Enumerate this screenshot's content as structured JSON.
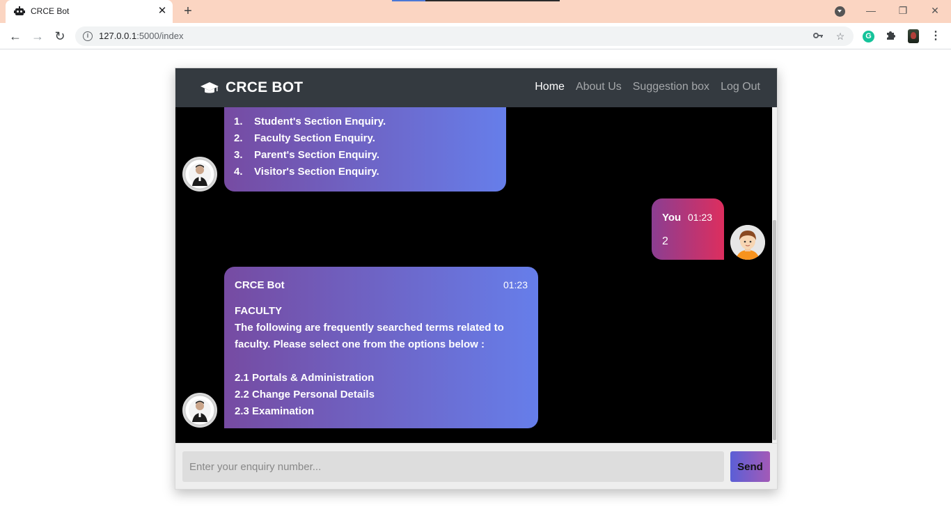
{
  "browser": {
    "tab_title": "CRCE Bot",
    "tab_close": "✕",
    "new_tab": "+",
    "url_host": "127.0.0.1",
    "url_rest": ":5000/index",
    "window_minimize": "—",
    "window_restore": "❐",
    "window_close": "✕"
  },
  "navbar": {
    "brand": "CRCE BOT",
    "links": [
      "Home",
      "About Us",
      "Suggestion box",
      "Log Out"
    ]
  },
  "chat": {
    "menu_message": {
      "items": [
        {
          "num": "1.",
          "text": "Student's Section Enquiry."
        },
        {
          "num": "2.",
          "text": "Faculty Section Enquiry."
        },
        {
          "num": "3.",
          "text": "Parent's Section Enquiry."
        },
        {
          "num": "4.",
          "text": "Visitor's Section Enquiry."
        }
      ]
    },
    "user_message": {
      "sender": "You",
      "time": "01:23",
      "text": "2"
    },
    "bot_message": {
      "sender": "CRCE Bot",
      "time": "01:23",
      "heading": "FACULTY",
      "intro": "The following are frequently searched terms related to faculty. Please select one from the options below :",
      "options": [
        "2.1 Portals & Administration",
        "2.2 Change Personal Details",
        "2.3 Examination"
      ]
    }
  },
  "input": {
    "placeholder": "Enter your enquiry number...",
    "send_label": "Send"
  }
}
